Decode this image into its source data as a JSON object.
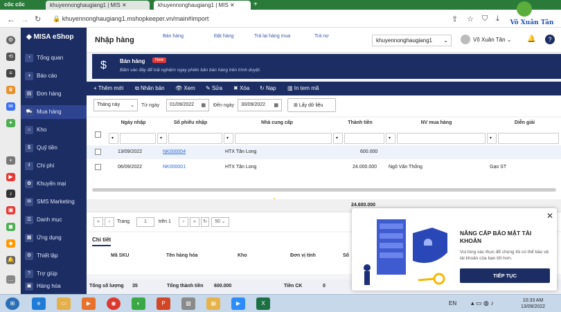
{
  "browser": {
    "brand": "cốc cốc",
    "tabs": [
      "khuyennonghaugiang1 | MIS",
      "khuyennonghaugiang1 | MIS"
    ],
    "url": "khuyennonghaugiang1.mshopkeeper.vn/main#import"
  },
  "watermark": {
    "text": "Võ Xuân Tân"
  },
  "app": {
    "logo": "MISA eShop",
    "sidebar": [
      "Tổng quan",
      "Báo cáo",
      "Đơn hàng",
      "Mua hàng",
      "Kho",
      "Quỹ tiền",
      "Chi phí",
      "Khuyến mại",
      "SMS Marketing",
      "Danh mục",
      "Ứng dụng",
      "Thiết lập",
      "Trợ giúp",
      "Hàng hóa"
    ],
    "active_item": "Mua hàng"
  },
  "header": {
    "title": "Nhập hàng",
    "quick_tabs": [
      "Bán hàng",
      "Đặt hàng",
      "Trả lại hàng mua",
      "Trả nợ"
    ],
    "store": "khuyennonghaugiang1",
    "user": "Võ Xuân Tân"
  },
  "banner": {
    "title": "Bán hàng",
    "badge": "New",
    "subtitle": "Bấm vào đây để trải nghiệm ngay phiên bản bán hàng trên trình duyệt."
  },
  "toolbar": [
    "Thêm mới",
    "Nhân bản",
    "Xem",
    "Sửa",
    "Xóa",
    "Nạp",
    "In tem mã"
  ],
  "filter": {
    "period": "Tháng này",
    "from_label": "Từ ngày",
    "from": "01/09/2022",
    "to_label": "Đến ngày",
    "to": "30/09/2022",
    "button": "Lấy dữ liệu"
  },
  "grid": {
    "columns": [
      "Ngày nhập",
      "Số phiếu nhập",
      "Nhà cung cấp",
      "Thành tiền",
      "NV mua hàng",
      "Diễn giải"
    ],
    "rows": [
      [
        "13/09/2022",
        "NK000004",
        "HTX Tân Long",
        "600.000",
        "",
        ""
      ],
      [
        "06/09/2022",
        "NK000001",
        "HTX Tân Long",
        "24.000.000",
        "Ngô Văn Thống",
        "Gạo ST"
      ]
    ],
    "total": "24.600.000"
  },
  "pager": {
    "label": "Trang",
    "page": "1",
    "of": "trên 1",
    "size": "50"
  },
  "detail": {
    "tab": "Chi tiết",
    "columns": [
      "Mã SKU",
      "Tên hàng hóa",
      "Kho",
      "Đơn vị tính",
      "Số"
    ],
    "summary": {
      "qty_label": "Tổng số lượng",
      "qty": "35",
      "amount_label": "Tổng thành tiền",
      "amount": "600.000",
      "ck_label": "Tiền CK",
      "ck": "0"
    }
  },
  "popup": {
    "title": "NÂNG CẤP BẢO MẬT TÀI KHOẢN",
    "message": "Vui lòng xác thực để chúng tôi có thể bảo vệ tài khoản của bạn tốt hơn.",
    "button": "TIẾP TỤC"
  },
  "taskbar": {
    "lang": "EN",
    "time": "10:33 AM",
    "date": "13/09/2022"
  }
}
